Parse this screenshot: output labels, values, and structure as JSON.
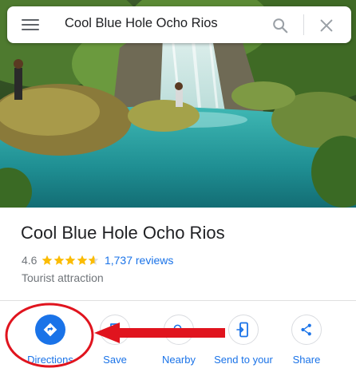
{
  "search": {
    "query": "Cool Blue Hole Ocho Rios"
  },
  "place": {
    "name": "Cool Blue Hole Ocho Rios",
    "rating": "4.6",
    "rating_stars": 4.6,
    "reviews": "1,737 reviews",
    "category": "Tourist attraction"
  },
  "actions": [
    {
      "label": "Directions",
      "icon": "directions-icon"
    },
    {
      "label": "Save",
      "icon": "bookmark-icon"
    },
    {
      "label": "Nearby",
      "icon": "nearby-icon"
    },
    {
      "label": "Send to your",
      "icon": "send-to-phone-icon"
    },
    {
      "label": "Share",
      "icon": "share-icon"
    }
  ],
  "colors": {
    "accent": "#1a73e8",
    "annotation": "#e0141e",
    "star": "#fbbc04"
  }
}
